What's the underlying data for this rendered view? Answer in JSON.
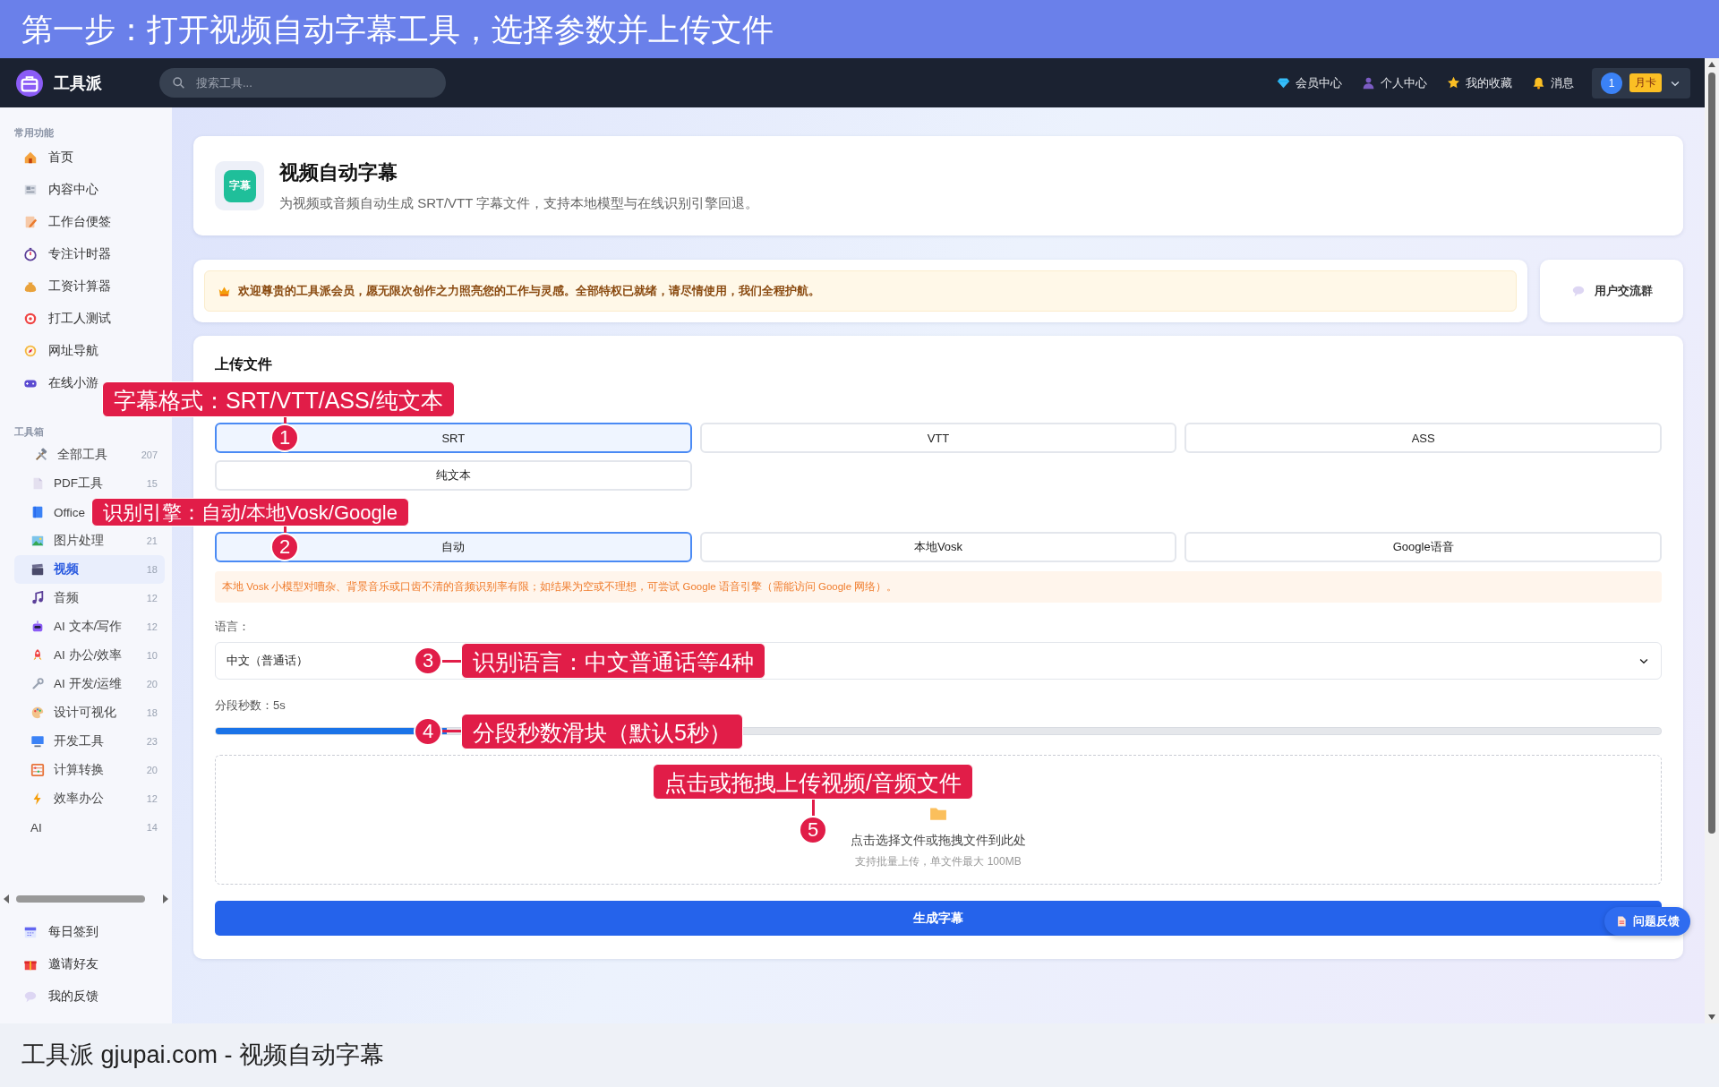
{
  "banner": {
    "title": "第一步：打开视频自动字幕工具，选择参数并上传文件"
  },
  "topbar": {
    "logo": "工具派",
    "search": {
      "placeholder": "搜索工具..."
    },
    "links": [
      "会员中心",
      "个人中心",
      "我的收藏",
      "消息"
    ],
    "user": {
      "avatar": "1",
      "badge": "月卡"
    }
  },
  "sidebar": {
    "groups": [
      {
        "title": "常用功能",
        "items": [
          {
            "label": "首页",
            "selected": false
          },
          {
            "label": "内容中心",
            "selected": false
          },
          {
            "label": "工作台便签",
            "selected": false
          },
          {
            "label": "专注计时器",
            "selected": false
          },
          {
            "label": "工资计算器",
            "selected": false
          },
          {
            "label": "打工人测试",
            "selected": false
          },
          {
            "label": "网址导航",
            "selected": false
          },
          {
            "label": "在线小游",
            "selected": false
          }
        ]
      },
      {
        "title": "工具箱",
        "items": [
          {
            "label": "全部工具",
            "count": "207",
            "selected": false,
            "children": [
              {
                "label": "PDF工具",
                "count": "15",
                "selected": false
              },
              {
                "label": "Office",
                "selected": false
              },
              {
                "label": "图片处理",
                "count": "21",
                "selected": false
              },
              {
                "label": "视频",
                "count": "18",
                "selected": true
              },
              {
                "label": "音频",
                "count": "12",
                "selected": false
              },
              {
                "label": "AI 文本/写作",
                "count": "12",
                "selected": false
              },
              {
                "label": "AI 办公/效率",
                "count": "10",
                "selected": false
              },
              {
                "label": "AI 开发/运维",
                "count": "20",
                "selected": false
              },
              {
                "label": "设计可视化",
                "count": "18",
                "selected": false
              },
              {
                "label": "开发工具",
                "count": "23",
                "selected": false
              },
              {
                "label": "计算转换",
                "count": "20",
                "selected": false
              },
              {
                "label": "效率办公",
                "count": "12",
                "selected": false
              },
              {
                "label": "AI",
                "count": "14",
                "selected": false
              }
            ]
          }
        ]
      }
    ],
    "footer": [
      {
        "label": "每日签到",
        "selected": false
      },
      {
        "label": "邀请好友",
        "selected": false
      },
      {
        "label": "我的反馈",
        "selected": false
      }
    ]
  },
  "tool": {
    "icon_text": "字幕",
    "title": "视频自动字幕",
    "description": "为视频或音频自动生成 SRT/VTT 字幕文件，支持本地模型与在线识别引擎回退。"
  },
  "notice": {
    "text": "欢迎尊贵的工具派会员，愿无限次创作之力照亮您的工作与灵感。全部特权已就绪，请尽情使用，我们全程护航。"
  },
  "community": {
    "label": "用户交流群"
  },
  "upload": {
    "title": "上传文件",
    "formats": [
      {
        "label": "SRT",
        "selected": true
      },
      {
        "label": "VTT",
        "selected": false
      },
      {
        "label": "ASS",
        "selected": false
      },
      {
        "label": "纯文本",
        "selected": false
      }
    ],
    "engines": [
      {
        "label": "自动",
        "selected": true
      },
      {
        "label": "本地Vosk",
        "selected": false
      },
      {
        "label": "Google语音",
        "selected": false
      }
    ],
    "engine_hint": "本地 Vosk 小模型对嘈杂、背景音乐或口齿不清的音频识别率有限；如结果为空或不理想，可尝试 Google 语音引擎（需能访问 Google 网络）。",
    "language_label": "语言：",
    "language": "中文（普通话）",
    "segment_label": "分段秒数：5s",
    "segment": {
      "level": 0.16
    },
    "dropzone": {
      "text": "点击选择文件或拖拽文件到此处",
      "hint": "支持批量上传，单文件最大 100MB"
    },
    "submit": "生成字幕"
  },
  "feedback_button": "问题反馈",
  "annotations": [
    {
      "number": "1",
      "text": "字幕格式：SRT/VTT/ASS/纯文本"
    },
    {
      "number": "2",
      "text": "识别引擎：自动/本地Vosk/Google"
    },
    {
      "number": "3",
      "text": "识别语言：中文普通话等4种"
    },
    {
      "number": "4",
      "text": "分段秒数滑块（默认5秒）"
    },
    {
      "number": "5",
      "text": "点击或拖拽上传视频/音频文件"
    }
  ],
  "caption": "工具派 gjupai.com - 视频自动字幕"
}
